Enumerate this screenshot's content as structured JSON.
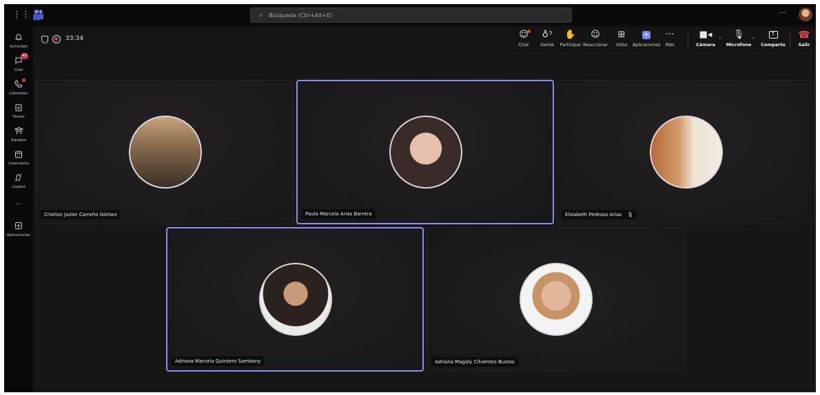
{
  "titlebar": {
    "search_placeholder": "Búsqueda (Ctrl+Alt+E)",
    "more": "···"
  },
  "rail": [
    {
      "label": "Actividad",
      "icon": "bell-icon"
    },
    {
      "label": "Chat",
      "icon": "chat-icon",
      "badge": "45"
    },
    {
      "label": "Llamadas",
      "icon": "phone-icon"
    },
    {
      "label": "Tareas",
      "icon": "tasks-icon"
    },
    {
      "label": "Equipos",
      "icon": "teams-icon"
    },
    {
      "label": "Calendario",
      "icon": "calendar-icon"
    },
    {
      "label": "Copilot",
      "icon": "copilot-icon"
    },
    {
      "label": "···",
      "icon": "more-icon"
    },
    {
      "label": "Aplicaciones",
      "icon": "apps-icon"
    }
  ],
  "meeting": {
    "timer": "33:34",
    "controls": {
      "chat": "Chat",
      "people": "Gente",
      "people_count": "5",
      "raise": "Participar",
      "react": "Reaccionar",
      "view": "Vista",
      "apps": "Aplicaciones",
      "more": "Más",
      "camera": "Cámara",
      "mic": "Micrófono",
      "share": "Comparte",
      "leave": "Salir"
    }
  },
  "participants": [
    {
      "name": "Cristian Javier Carreño Gómez",
      "speaking": false,
      "muted": false
    },
    {
      "name": "Paula Marcela Arias Barrera",
      "speaking": true,
      "muted": false
    },
    {
      "name": "Elizabeth Pedroza Arias",
      "speaking": false,
      "muted": true
    },
    {
      "name": "Adriana Marcela Quintero Sambony",
      "speaking": true,
      "muted": false
    },
    {
      "name": "Adriana Magaly Cifuentes Bustos",
      "speaking": false,
      "muted": false
    }
  ],
  "colors": {
    "accent": "#8b8ff0",
    "leave": "#e5484d",
    "badge": "#c4314b"
  }
}
